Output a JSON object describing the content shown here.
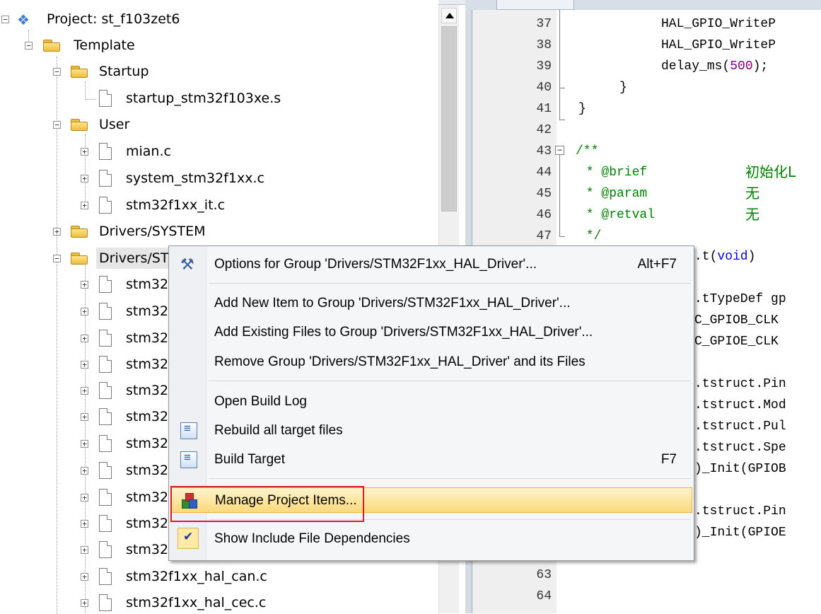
{
  "tree": {
    "project": "Project: st_f103zet6",
    "target": "Template",
    "groups": {
      "startup": "Startup",
      "startup_file": "startup_stm32f103xe.s",
      "user": "User",
      "user_files": [
        "mian.c",
        "system_stm32f1xx.c",
        "stm32f1xx_it.c"
      ],
      "drivers_system": "Drivers/SYSTEM",
      "drivers_hal_truncated": "Drivers/ST",
      "hal_file_prefix": "stm32",
      "hal_files_visible": [
        "stm32f1xx_hal_can.c",
        "stm32f1xx_hal_cec.c"
      ]
    }
  },
  "editor": {
    "line_numbers": [
      "37",
      "38",
      "39",
      "40",
      "41",
      "42",
      "43",
      "44",
      "45",
      "46",
      "47",
      "63",
      "64"
    ],
    "code": {
      "l37": "HAL_GPIO_WriteP",
      "l38": "HAL_GPIO_WriteP",
      "l39_fn": "delay_ms(",
      "l39_num": "500",
      "l39_end": ");",
      "l40": "}",
      "l41": "}",
      "l43": "/**",
      "l44_tag": " * @brief",
      "l44_cn": "初始化L",
      "l45_tag": " * @param",
      "l45_cn": "无",
      "l46_tag": " * @retval",
      "l46_cn": "无",
      "l47": " */",
      "r1_pre": ".t(",
      "r1_kw": "void",
      "r1_post": ")",
      "r2": ".tTypeDef gp",
      "r3": "C_GPIOB_CLK",
      "r4": "C_GPIOE_CLK",
      "r5": ".tstruct.Pin",
      "r6": ".tstruct.Mod",
      "r7": ".tstruct.Pul",
      "r8": ".tstruct.Spe",
      "r9": ")_Init(GPIOB",
      "r10": ".tstruct.Pin",
      "r11": ")_Init(GPIOE"
    }
  },
  "context_menu": {
    "options": "Options for Group 'Drivers/STM32F1xx_HAL_Driver'...",
    "options_shortcut": "Alt+F7",
    "add_new": "Add New  Item to Group 'Drivers/STM32F1xx_HAL_Driver'...",
    "add_existing": "Add Existing Files to Group 'Drivers/STM32F1xx_HAL_Driver'...",
    "remove_group": "Remove Group 'Drivers/STM32F1xx_HAL_Driver' and its Files",
    "open_build_log": "Open Build Log",
    "rebuild_all": "Rebuild all target files",
    "build_target": "Build Target",
    "build_target_shortcut": "F7",
    "manage_items": "Manage Project Items...",
    "show_include_deps": "Show Include File Dependencies"
  },
  "colors": {
    "menu_highlight": "#fbd97a",
    "annotation_red": "#d81e1e",
    "comment_green": "#008000",
    "keyword_blue": "#0000ff"
  }
}
